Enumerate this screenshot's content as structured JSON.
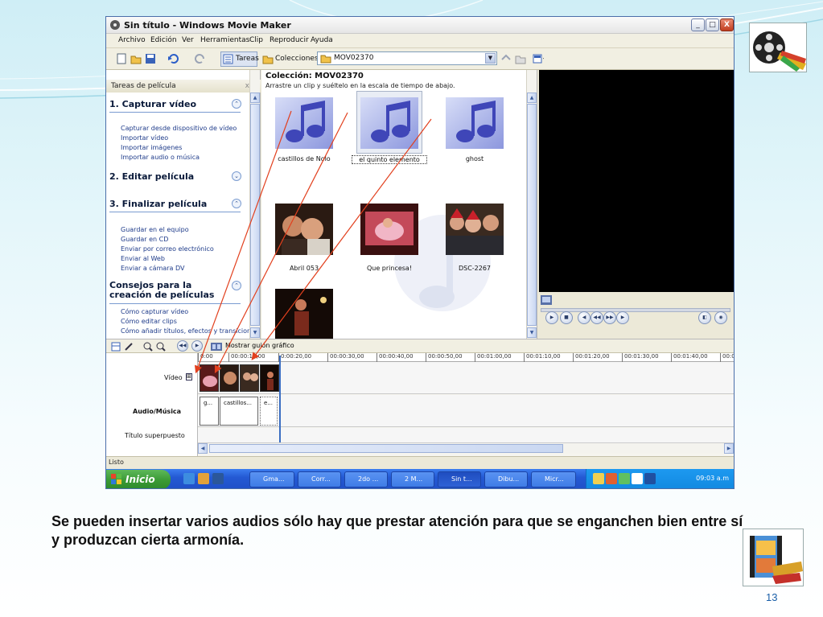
{
  "window": {
    "title": "Sin título - Windows Movie Maker",
    "min_glyph": "_",
    "max_glyph": "□",
    "close_glyph": "X"
  },
  "menu": [
    "Archivo",
    "Edición",
    "Ver",
    "Herramientas",
    "Clip",
    "Reproducir",
    "Ayuda"
  ],
  "toolbar": {
    "tasks_label": "Tareas",
    "collections_label": "Colecciones",
    "collection_value": "MOV02370"
  },
  "taskpane": {
    "header": "Tareas de película",
    "close": "x",
    "sections": [
      {
        "title": "1. Capturar vídeo",
        "glyph": "⌃",
        "links": [
          "Capturar desde dispositivo de vídeo",
          "Importar vídeo",
          "Importar imágenes",
          "Importar audio o música"
        ]
      },
      {
        "title": "2. Editar película",
        "glyph": "⌄",
        "links": []
      },
      {
        "title": "3. Finalizar película",
        "glyph": "⌃",
        "links": [
          "Guardar en el equipo",
          "Guardar en CD",
          "Enviar por correo electrónico",
          "Enviar al Web",
          "Enviar a cámara DV"
        ]
      },
      {
        "title": "Consejos para la creación de películas",
        "glyph": "⌃",
        "links": [
          "Cómo capturar vídeo",
          "Cómo editar clips",
          "Cómo añadir títulos, efectos y transiciones"
        ]
      }
    ]
  },
  "collection": {
    "title": "Colección: MOV02370",
    "subtitle": "Arrastre un clip y suéltelo en la escala de tiempo de abajo.",
    "items": [
      {
        "label": "castillos de Nolo",
        "kind": "audio"
      },
      {
        "label": "el quinto elemento",
        "kind": "audio"
      },
      {
        "label": "ghost",
        "kind": "audio"
      },
      {
        "label": "Abril 053",
        "kind": "photo"
      },
      {
        "label": "Que princesa!",
        "kind": "photo"
      },
      {
        "label": "DSC-2267",
        "kind": "photo"
      },
      {
        "label": "",
        "kind": "photo"
      }
    ]
  },
  "timeline": {
    "toolbar_label": "Mostrar guión gráfico",
    "ticks": [
      "0:00",
      "00:00:10,00",
      "0:00:20,00",
      "00:00:30,00",
      "00:00:40,00",
      "00:00:50,00",
      "00:01:00,00",
      "00:01:10,00",
      "00:01:20,00",
      "00:01:30,00",
      "00:01:40,00",
      "00:0"
    ],
    "tracks": {
      "video": "Vídeo",
      "video_toggle": "⊞",
      "audio": "Audio/Música",
      "title_overlay": "Título superpuesto"
    },
    "audio_clips": [
      "g...",
      "castillos...",
      "e..."
    ]
  },
  "status": {
    "text": "Listo"
  },
  "taskbar": {
    "start": "Inicio",
    "tasks": [
      "Gma...",
      "Corr...",
      "2do ...",
      "2 M...",
      "Sin t...",
      "Dibu...",
      "Micr..."
    ],
    "clock": "09:03 a.m"
  },
  "caption": "Se pueden insertar varios audios sólo hay que prestar atención para que se enganchen bien entre sí y produzcan cierta armonía.",
  "page_number": "13"
}
